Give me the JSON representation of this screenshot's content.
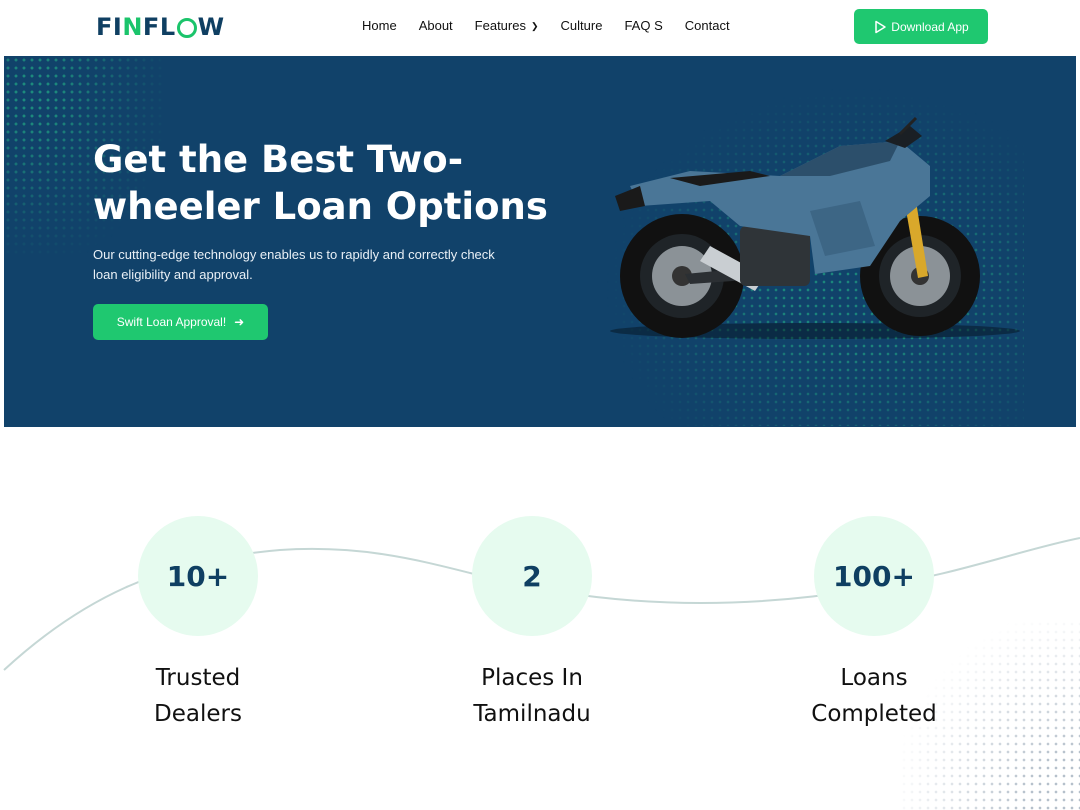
{
  "brand": {
    "logo_text_pre": "FI",
    "logo_text_n": "N",
    "logo_text_mid": "FL",
    "logo_text_post": "W"
  },
  "nav": {
    "items": [
      {
        "label": "Home"
      },
      {
        "label": "About"
      },
      {
        "label": "Features",
        "has_dropdown": true
      },
      {
        "label": "Culture"
      },
      {
        "label": "FAQ S"
      },
      {
        "label": "Contact"
      }
    ],
    "download_label": "Download App"
  },
  "hero": {
    "title_line1": "Get the Best Two-",
    "title_line2": "wheeler Loan Options",
    "description_line1": "Our cutting-edge technology enables us to rapidly and correctly check",
    "description_line2": "loan eligibility and approval.",
    "cta_label": "Swift Loan Approval!",
    "image_icon": "motorcycle-image"
  },
  "stats": [
    {
      "value": "10+",
      "label_line1": "Trusted",
      "label_line2": "Dealers"
    },
    {
      "value": "2",
      "label_line1": "Places In",
      "label_line2": "Tamilnadu"
    },
    {
      "value": "100+",
      "label_line1": "Loans",
      "label_line2": "Completed"
    }
  ],
  "colors": {
    "brand_navy": "#0f3f62",
    "accent_green": "#1fc870",
    "hero_bg": "#11426a",
    "stat_circle_bg": "#e6fbef"
  }
}
